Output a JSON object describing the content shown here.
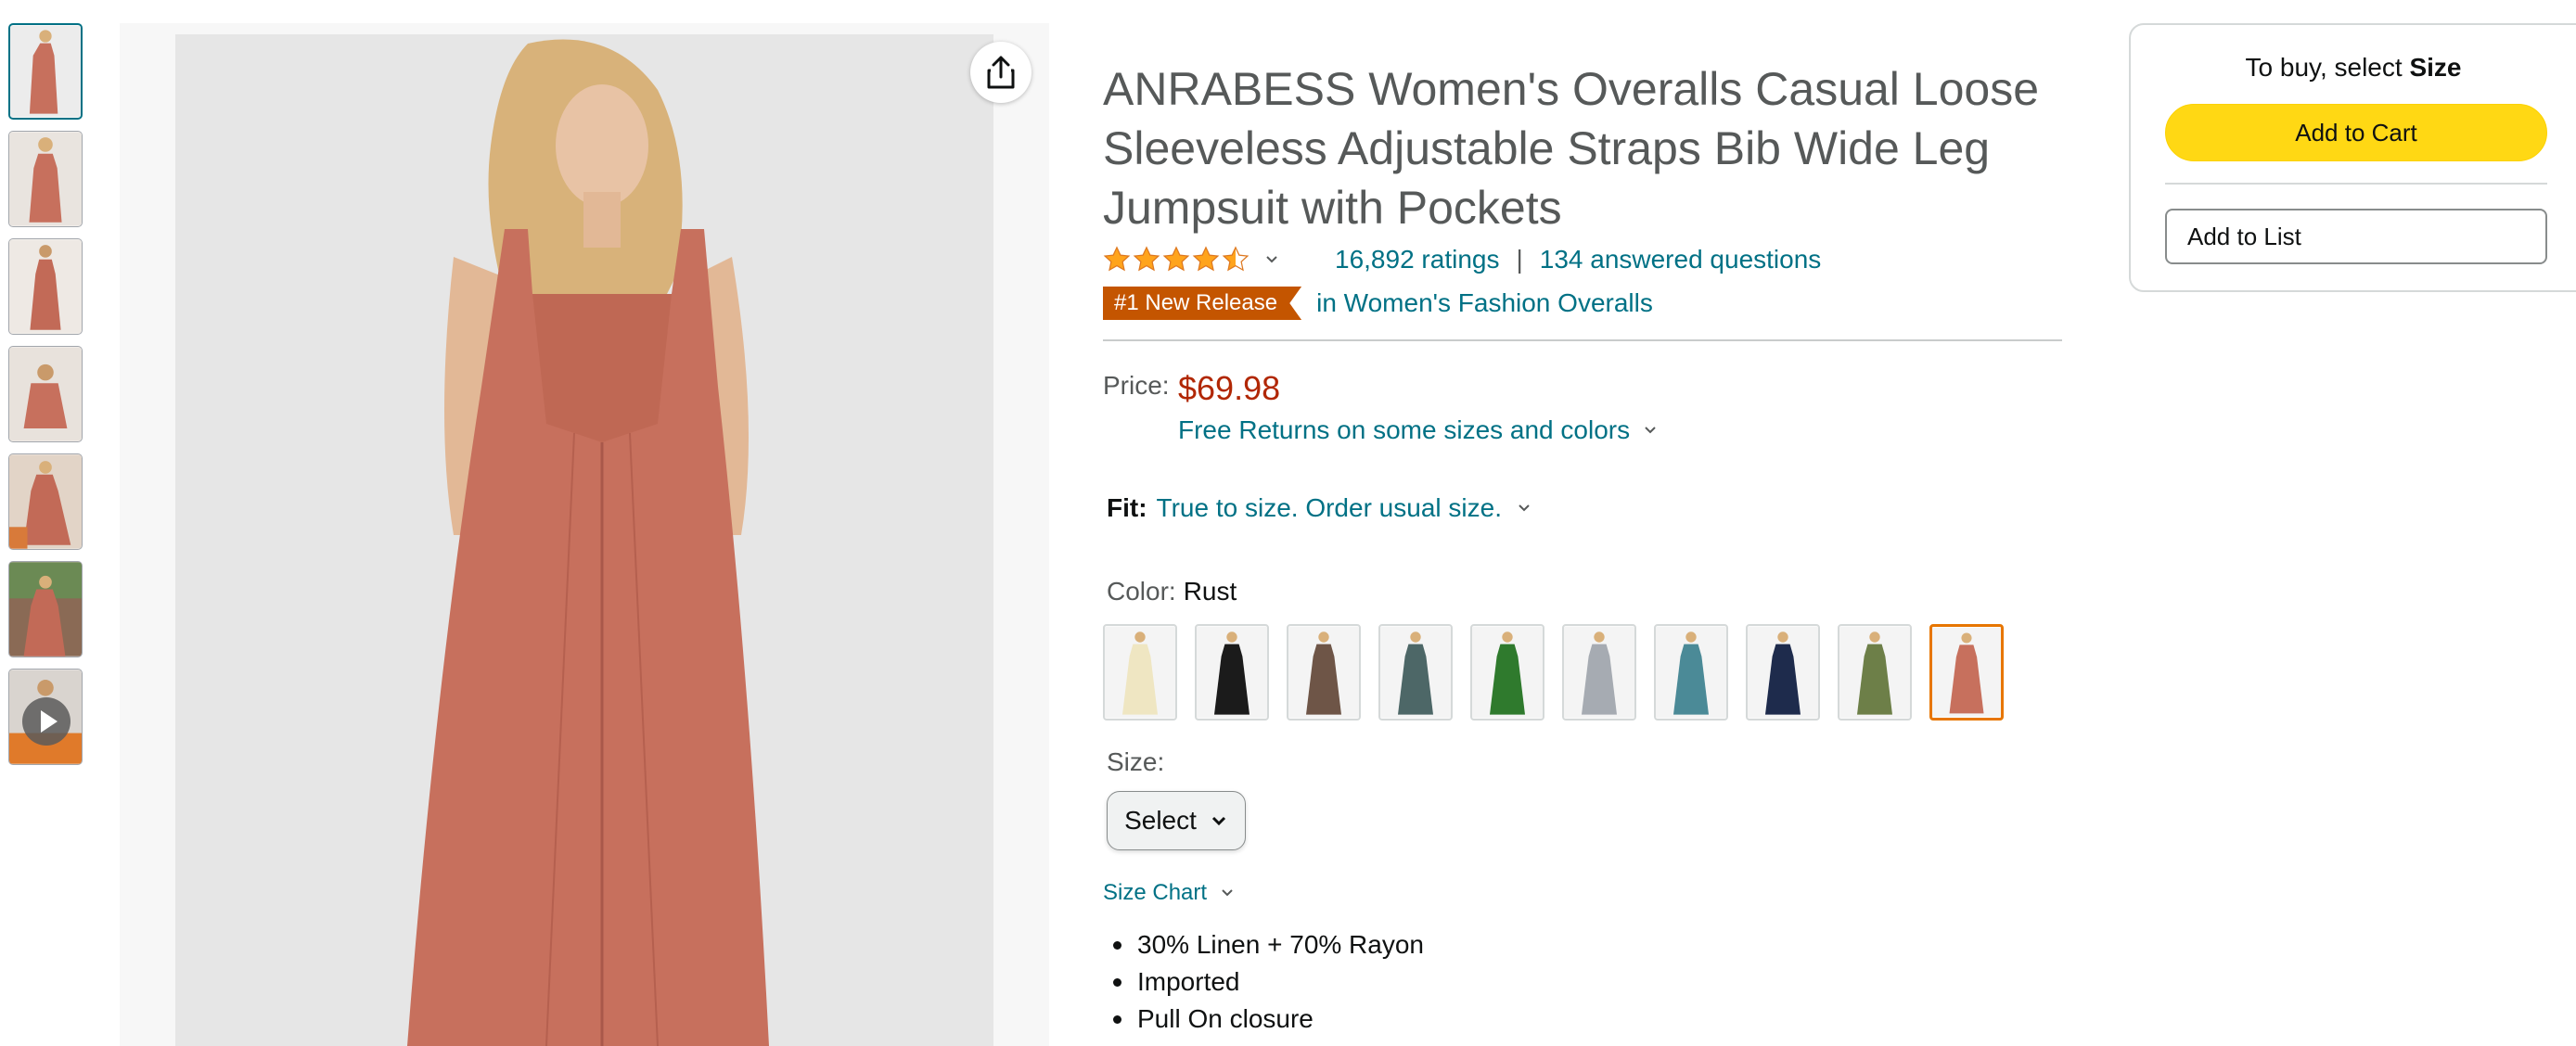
{
  "gallery": {
    "thumbnails": [
      {
        "kind": "image",
        "selected": true
      },
      {
        "kind": "image",
        "selected": false
      },
      {
        "kind": "image",
        "selected": false
      },
      {
        "kind": "image",
        "selected": false
      },
      {
        "kind": "image",
        "selected": false
      },
      {
        "kind": "image",
        "selected": false
      },
      {
        "kind": "video",
        "selected": false
      }
    ],
    "share_icon": "share-icon"
  },
  "product": {
    "title": "ANRABESS Women's Overalls Casual Loose Sleeveless Adjustable Straps Bib Wide Leg Jumpsuit with Pockets",
    "rating_stars": 4.5,
    "ratings_count": "16,892 ratings",
    "separator": "|",
    "answered_questions": "134 answered questions",
    "badge": "#1 New Release",
    "badge_category": "in Women's Fashion Overalls",
    "price_label": "Price:",
    "price": "$69.98",
    "free_returns": "Free Returns on some sizes and colors",
    "fit_label": "Fit:",
    "fit_value": "True to size. Order usual size.",
    "color_label": "Color:",
    "color_value": "Rust",
    "swatches": [
      {
        "name": "cream",
        "color": "#efe6c2"
      },
      {
        "name": "black",
        "color": "#1b1b1b"
      },
      {
        "name": "brown",
        "color": "#6e5547"
      },
      {
        "name": "slate-green",
        "color": "#4d6767"
      },
      {
        "name": "green",
        "color": "#2f7a2d"
      },
      {
        "name": "light-gray",
        "color": "#a6abb2"
      },
      {
        "name": "teal",
        "color": "#4b8a97"
      },
      {
        "name": "navy",
        "color": "#1e2b4c"
      },
      {
        "name": "olive",
        "color": "#6d7f48"
      },
      {
        "name": "rust",
        "color": "#c7705d",
        "selected": true
      }
    ],
    "size_label": "Size:",
    "size_select": "Select",
    "size_chart": "Size Chart",
    "bullets": [
      "30% Linen + 70% Rayon",
      "Imported",
      "Pull On closure"
    ]
  },
  "buybox": {
    "prompt_prefix": "To buy, select ",
    "prompt_bold": "Size",
    "add_to_cart": "Add to Cart",
    "add_to_list": "Add to List"
  },
  "colors": {
    "link": "#007185",
    "price": "#b12704",
    "badge": "#c45500",
    "cart_button": "#ffd814",
    "selected_swatch_border": "#e77600",
    "star": "#ffa41c"
  }
}
